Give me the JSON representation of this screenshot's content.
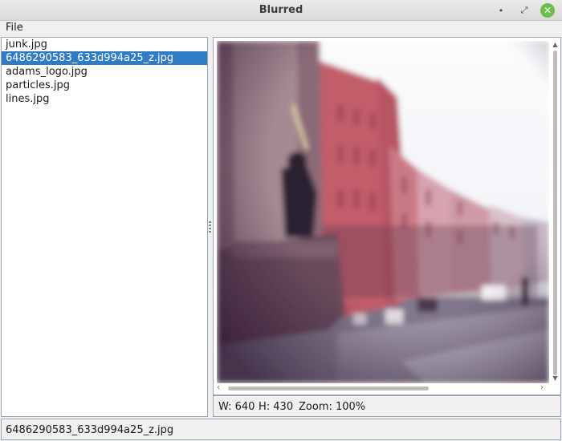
{
  "window": {
    "title": "Blurred",
    "minimize_glyph": "•",
    "maximize_glyph": "⤢",
    "close_glyph": "✕"
  },
  "menu": {
    "file": "File"
  },
  "files": [
    "junk.jpg",
    "6486290583_633d994a25_z.jpg",
    "adams_logo.jpg",
    "particles.jpg",
    "lines.jpg"
  ],
  "selected_index": 1,
  "viewer": {
    "scroll_up": "▲",
    "scroll_down": "▼",
    "scroll_left": "‹",
    "scroll_right": "›"
  },
  "info": {
    "width": "W: 640",
    "height": "H: 430",
    "zoom": "Zoom: 100%"
  },
  "status": {
    "filename": "6486290583_633d994a25_z.jpg"
  }
}
